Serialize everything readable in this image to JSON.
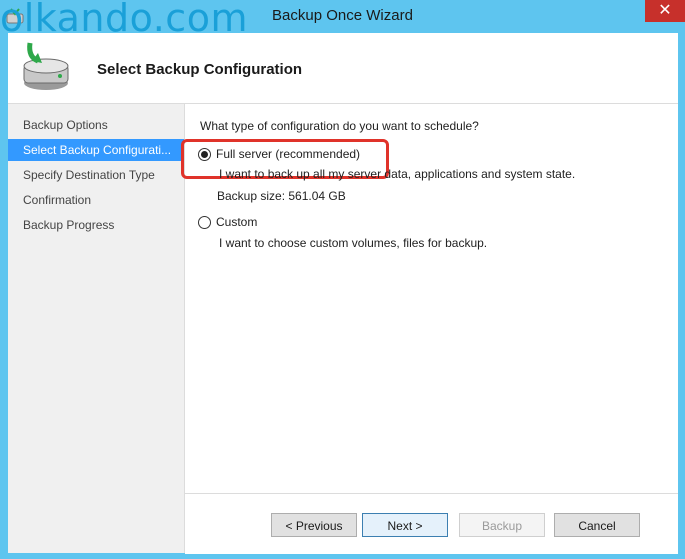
{
  "window": {
    "title": "Backup Once Wizard",
    "watermark": "olkando.com",
    "close_label": "✕"
  },
  "header": {
    "title": "Select Backup Configuration"
  },
  "sidebar": {
    "items": [
      {
        "label": "Backup Options"
      },
      {
        "label": "Select Backup Configurati..."
      },
      {
        "label": "Specify Destination Type"
      },
      {
        "label": "Confirmation"
      },
      {
        "label": "Backup Progress"
      }
    ]
  },
  "main": {
    "question": "What type of configuration do you want to schedule?",
    "options": [
      {
        "label": "Full server (recommended)",
        "description": "I want to back up all my server data, applications and system state.",
        "size": "Backup size: 561.04 GB",
        "selected": true
      },
      {
        "label": "Custom",
        "description": "I want to choose custom volumes, files for backup.",
        "selected": false
      }
    ]
  },
  "footer": {
    "previous_label": "< Previous",
    "next_label": "Next >",
    "backup_label": "Backup",
    "cancel_label": "Cancel"
  },
  "colors": {
    "title_bar": "#5ec5ef",
    "close_button": "#c7302b",
    "selected_step": "#3399ff",
    "highlight_box": "#e0332a"
  }
}
